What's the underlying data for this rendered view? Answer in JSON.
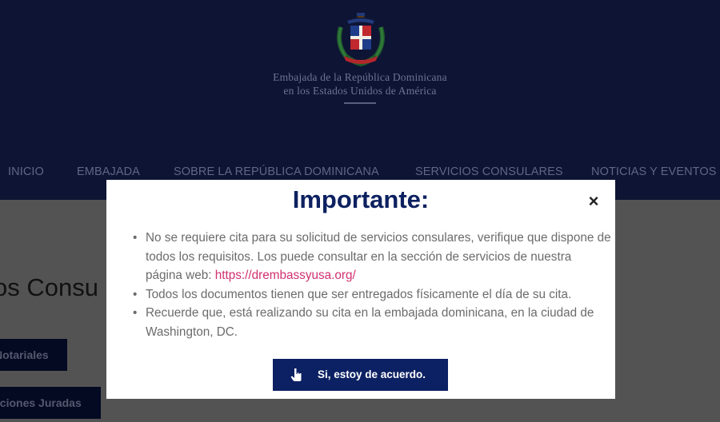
{
  "header": {
    "embassy_line1": "Embajada de la República Dominicana",
    "embassy_line2": "en los Estados Unidos de América"
  },
  "nav": {
    "items": [
      {
        "label": "INICIO"
      },
      {
        "label": "EMBAJADA"
      },
      {
        "label": "SOBRE LA REPÚBLICA DOMINICANA"
      },
      {
        "label": "SERVICIOS CONSULARES"
      },
      {
        "label": "NOTICIAS Y EVENTOS"
      }
    ]
  },
  "page": {
    "heading": "os Consu",
    "buttons": [
      {
        "label": "Notariales"
      },
      {
        "label": "aciones Juradas"
      }
    ]
  },
  "modal": {
    "title": "Importante:",
    "close_symbol": "×",
    "items": [
      {
        "text": "No se requiere cita para su solicitud de servicios consulares, verifique que dispone de todos los requisitos. Los puede consultar en la sección de servicios de nuestra página web: ",
        "link": "https://drembassyusa.org/"
      },
      {
        "text": "Todos los documentos tienen que ser entregados físicamente el día de su cita."
      },
      {
        "text": "Recuerde que, está realizando su cita en la embajada dominicana, en la ciudad de Washington, DC."
      }
    ],
    "agree_label": "Si, estoy de acuerdo.",
    "agree_icon": "pointing-hand-icon"
  },
  "colors": {
    "header_bg": "#0e1434",
    "overlay_bg": "#535353",
    "modal_title": "#0d2160",
    "link": "#d1306e",
    "button_bg": "#0c2163"
  }
}
